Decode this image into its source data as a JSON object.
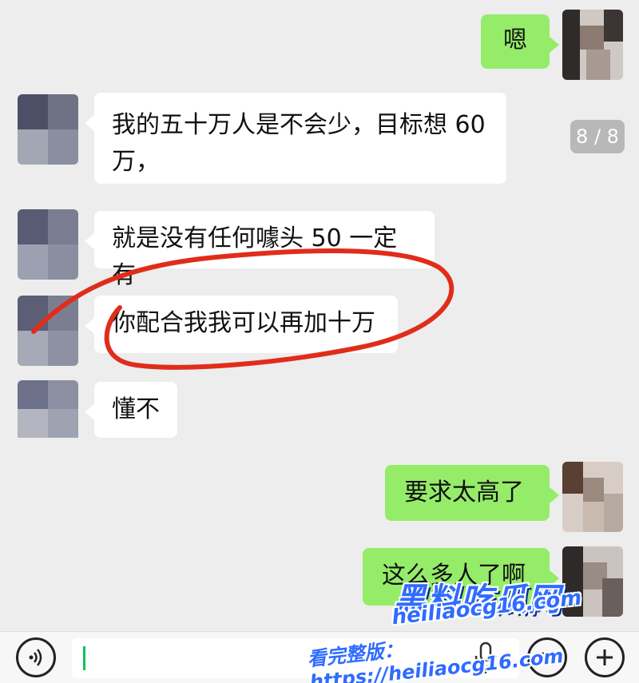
{
  "counter": "8 / 8",
  "messages": [
    {
      "text": "嗯",
      "side": "out"
    },
    {
      "text": "我的五十万人是不会少，目标想 60 万，",
      "side": "in"
    },
    {
      "text": "就是没有任何噱头 50 一定有",
      "side": "in"
    },
    {
      "text": "你配合我我可以再加十万",
      "side": "in"
    },
    {
      "text": "懂不",
      "side": "in"
    },
    {
      "text": "要求太高了",
      "side": "out"
    },
    {
      "text": "这么多人了啊",
      "side": "out"
    }
  ],
  "message_line1": "我的五十万人是不会少，目标想 60",
  "message_line2": "万，",
  "watermark": {
    "title": "黑料吃瓜网",
    "url": "heiliaocg16.com",
    "line": "看完整版：https://heiliaocg16.com"
  },
  "colors": {
    "background": "#ededed",
    "incoming_bubble": "#ffffff",
    "outgoing_bubble": "#95ec69",
    "annotation_circle": "#e02d1b"
  },
  "icons": [
    "voice-icon",
    "microphone-icon",
    "emoji-icon",
    "plus-icon"
  ]
}
